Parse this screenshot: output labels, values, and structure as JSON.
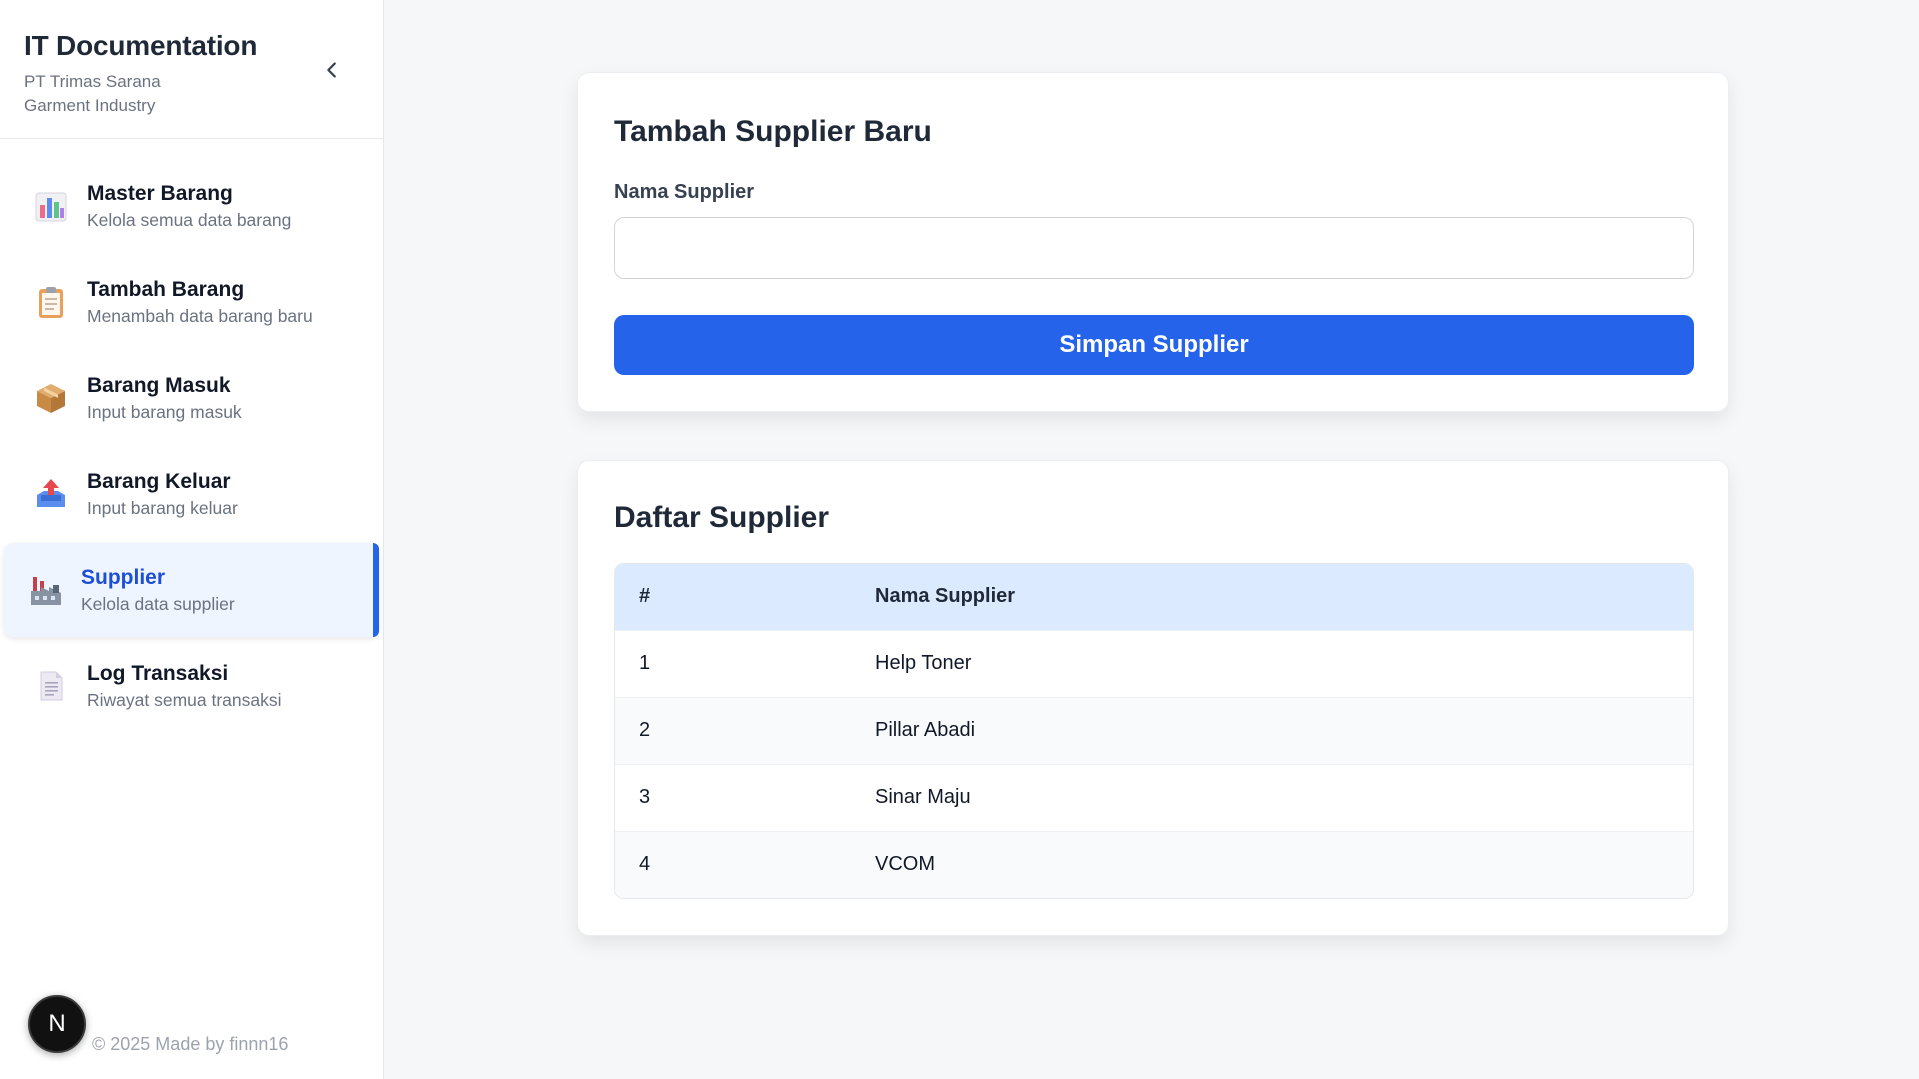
{
  "sidebar": {
    "title": "IT Documentation",
    "subtitle": "PT Trimas Sarana Garment Industry",
    "items": [
      {
        "label": "Master Barang",
        "desc": "Kelola semua data barang",
        "icon": "bar-chart-icon"
      },
      {
        "label": "Tambah Barang",
        "desc": "Menambah data barang baru",
        "icon": "clipboard-icon"
      },
      {
        "label": "Barang Masuk",
        "desc": "Input barang masuk",
        "icon": "package-icon"
      },
      {
        "label": "Barang Keluar",
        "desc": "Input barang keluar",
        "icon": "outbox-tray-icon"
      },
      {
        "label": "Supplier",
        "desc": "Kelola data supplier",
        "icon": "factory-icon",
        "active": true
      },
      {
        "label": "Log Transaksi",
        "desc": "Riwayat semua transaksi",
        "icon": "document-icon"
      }
    ],
    "footer_avatar": "N",
    "footer_text": "© 2025 Made by finnn16"
  },
  "form": {
    "title": "Tambah Supplier Baru",
    "field_label": "Nama Supplier",
    "field_value": "",
    "field_placeholder": "",
    "submit_label": "Simpan Supplier"
  },
  "list": {
    "title": "Daftar Supplier",
    "columns": [
      "#",
      "Nama Supplier"
    ],
    "rows": [
      [
        "1",
        "Help Toner"
      ],
      [
        "2",
        "Pillar Abadi"
      ],
      [
        "3",
        "Sinar Maju"
      ],
      [
        "4",
        "VCOM"
      ]
    ]
  },
  "colors": {
    "accent": "#2563eb",
    "active_bg": "#eef5ff",
    "table_header_bg": "#dbeafe"
  }
}
